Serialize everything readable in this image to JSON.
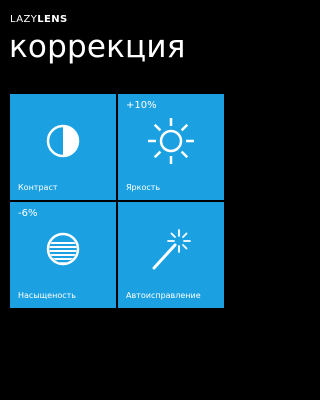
{
  "app": {
    "title_light": "LAZY",
    "title_bold": "LENS"
  },
  "page": {
    "title": "коррекция"
  },
  "colors": {
    "background": "#000000",
    "tile": "#1ba1e2",
    "foreground": "#ffffff"
  },
  "tiles": [
    {
      "label": "Контраст",
      "value": "",
      "icon": "contrast-icon"
    },
    {
      "label": "Яркость",
      "value": "+10%",
      "icon": "sun-icon"
    },
    {
      "label": "Насыщеность",
      "value": "-6%",
      "icon": "saturation-icon"
    },
    {
      "label": "Автоисправление",
      "value": "",
      "icon": "magic-wand-icon"
    }
  ]
}
